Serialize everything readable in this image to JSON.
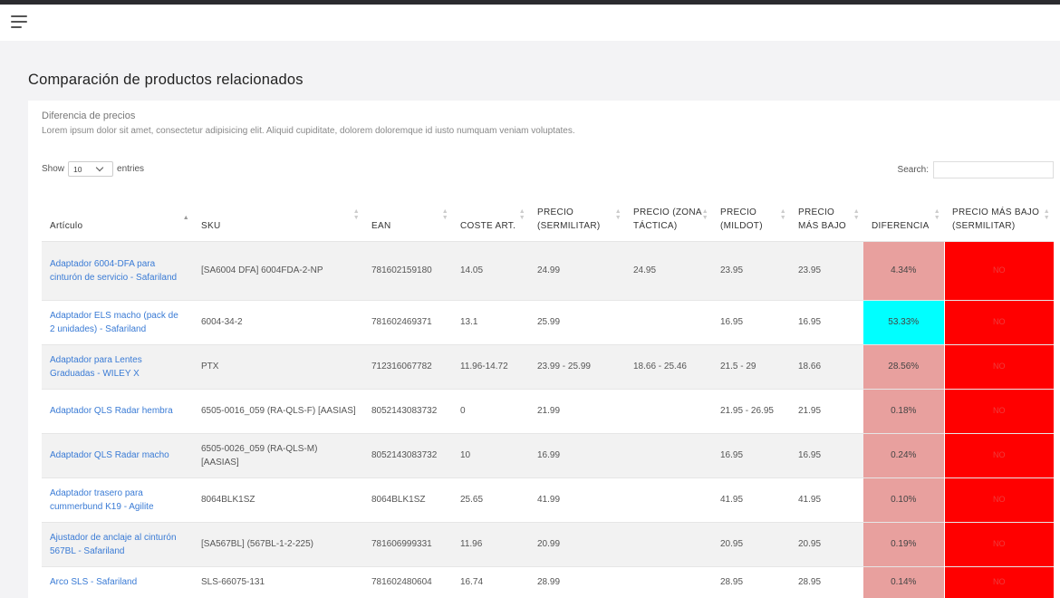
{
  "header": {
    "menu_icon": "hamburger-menu-icon"
  },
  "page": {
    "title": "Comparación de productos relacionados"
  },
  "card": {
    "title": "Diferencia de precios",
    "description": "Lorem ipsum dolor sit amet, consectetur adipisicing elit. Aliquid cupiditate, dolorem doloremque id iusto numquam veniam voluptates."
  },
  "table_controls": {
    "show_label": "Show",
    "length_value": "10",
    "entries_label": "entries",
    "search_label": "Search:",
    "search_placeholder": ""
  },
  "colors": {
    "diff_default": "#e8a09e",
    "diff_highlight": "#00ffff",
    "lowest_no": "#ff0000",
    "link": "#3a7bd5"
  },
  "table": {
    "columns": [
      "Artículo",
      "SKU",
      "EAN",
      "COSTE ART.",
      "PRECIO (SERMILITAR)",
      "PRECIO (ZONA TÁCTICA)",
      "PRECIO (MILDOT)",
      "PRECIO MÁS BAJO",
      "DIFERENCIA",
      "PRECIO MÁS BAJO (SERMILITAR)"
    ],
    "rows": [
      {
        "articulo": "Adaptador 6004-DFA para cinturón de servicio - Safariland",
        "sku": "[SA6004 DFA] 6004FDA-2-NP",
        "ean": "781602159180",
        "coste": "14.05",
        "sermilitar": "24.99",
        "zona": "24.95",
        "mildot": "23.95",
        "bajo": "23.95",
        "diferencia": "4.34%",
        "diff_color": "#e8a09e",
        "mas_bajo_sermilitar": "NO"
      },
      {
        "articulo": "Adaptador ELS macho (pack de 2 unidades) - Safariland",
        "sku": "6004-34-2",
        "ean": "781602469371",
        "coste": "13.1",
        "sermilitar": "25.99",
        "zona": "",
        "mildot": "16.95",
        "bajo": "16.95",
        "diferencia": "53.33%",
        "diff_color": "#00ffff",
        "mas_bajo_sermilitar": "NO"
      },
      {
        "articulo": "Adaptador para Lentes Graduadas - WILEY X",
        "sku": "PTX",
        "ean": "712316067782",
        "coste": "11.96-14.72",
        "sermilitar": "23.99 - 25.99",
        "zona": "18.66 - 25.46",
        "mildot": "21.5 - 29",
        "bajo": "18.66",
        "diferencia": "28.56%",
        "diff_color": "#e8a09e",
        "mas_bajo_sermilitar": "NO"
      },
      {
        "articulo": "Adaptador QLS Radar hembra",
        "sku": "6505-0016_059 (RA-QLS-F) [AASIAS]",
        "ean": "8052143083732",
        "coste": "0",
        "sermilitar": "21.99",
        "zona": "",
        "mildot": "21.95 - 26.95",
        "bajo": "21.95",
        "diferencia": "0.18%",
        "diff_color": "#e8a09e",
        "mas_bajo_sermilitar": "NO"
      },
      {
        "articulo": "Adaptador QLS Radar macho",
        "sku": "6505-0026_059 (RA-QLS-M) [AASIAS]",
        "ean": "8052143083732",
        "coste": "10",
        "sermilitar": "16.99",
        "zona": "",
        "mildot": "16.95",
        "bajo": "16.95",
        "diferencia": "0.24%",
        "diff_color": "#e8a09e",
        "mas_bajo_sermilitar": "NO"
      },
      {
        "articulo": "Adaptador trasero para cummerbund K19 - Agilite",
        "sku": "8064BLK1SZ",
        "ean": "8064BLK1SZ",
        "coste": "25.65",
        "sermilitar": "41.99",
        "zona": "",
        "mildot": "41.95",
        "bajo": "41.95",
        "diferencia": "0.10%",
        "diff_color": "#e8a09e",
        "mas_bajo_sermilitar": "NO"
      },
      {
        "articulo": "Ajustador de anclaje al cinturón 567BL - Safariland",
        "sku": "[SA567BL] (567BL-1-2-225)",
        "ean": "781606999331",
        "coste": "11.96",
        "sermilitar": "20.99",
        "zona": "",
        "mildot": "20.95",
        "bajo": "20.95",
        "diferencia": "0.19%",
        "diff_color": "#e8a09e",
        "mas_bajo_sermilitar": "NO"
      },
      {
        "articulo": "Arco SLS - Safariland",
        "sku": "SLS-66075-131",
        "ean": "781602480604",
        "coste": "16.74",
        "sermilitar": "28.99",
        "zona": "",
        "mildot": "28.95",
        "bajo": "28.95",
        "diferencia": "0.14%",
        "diff_color": "#e8a09e",
        "mas_bajo_sermilitar": "NO"
      }
    ]
  }
}
